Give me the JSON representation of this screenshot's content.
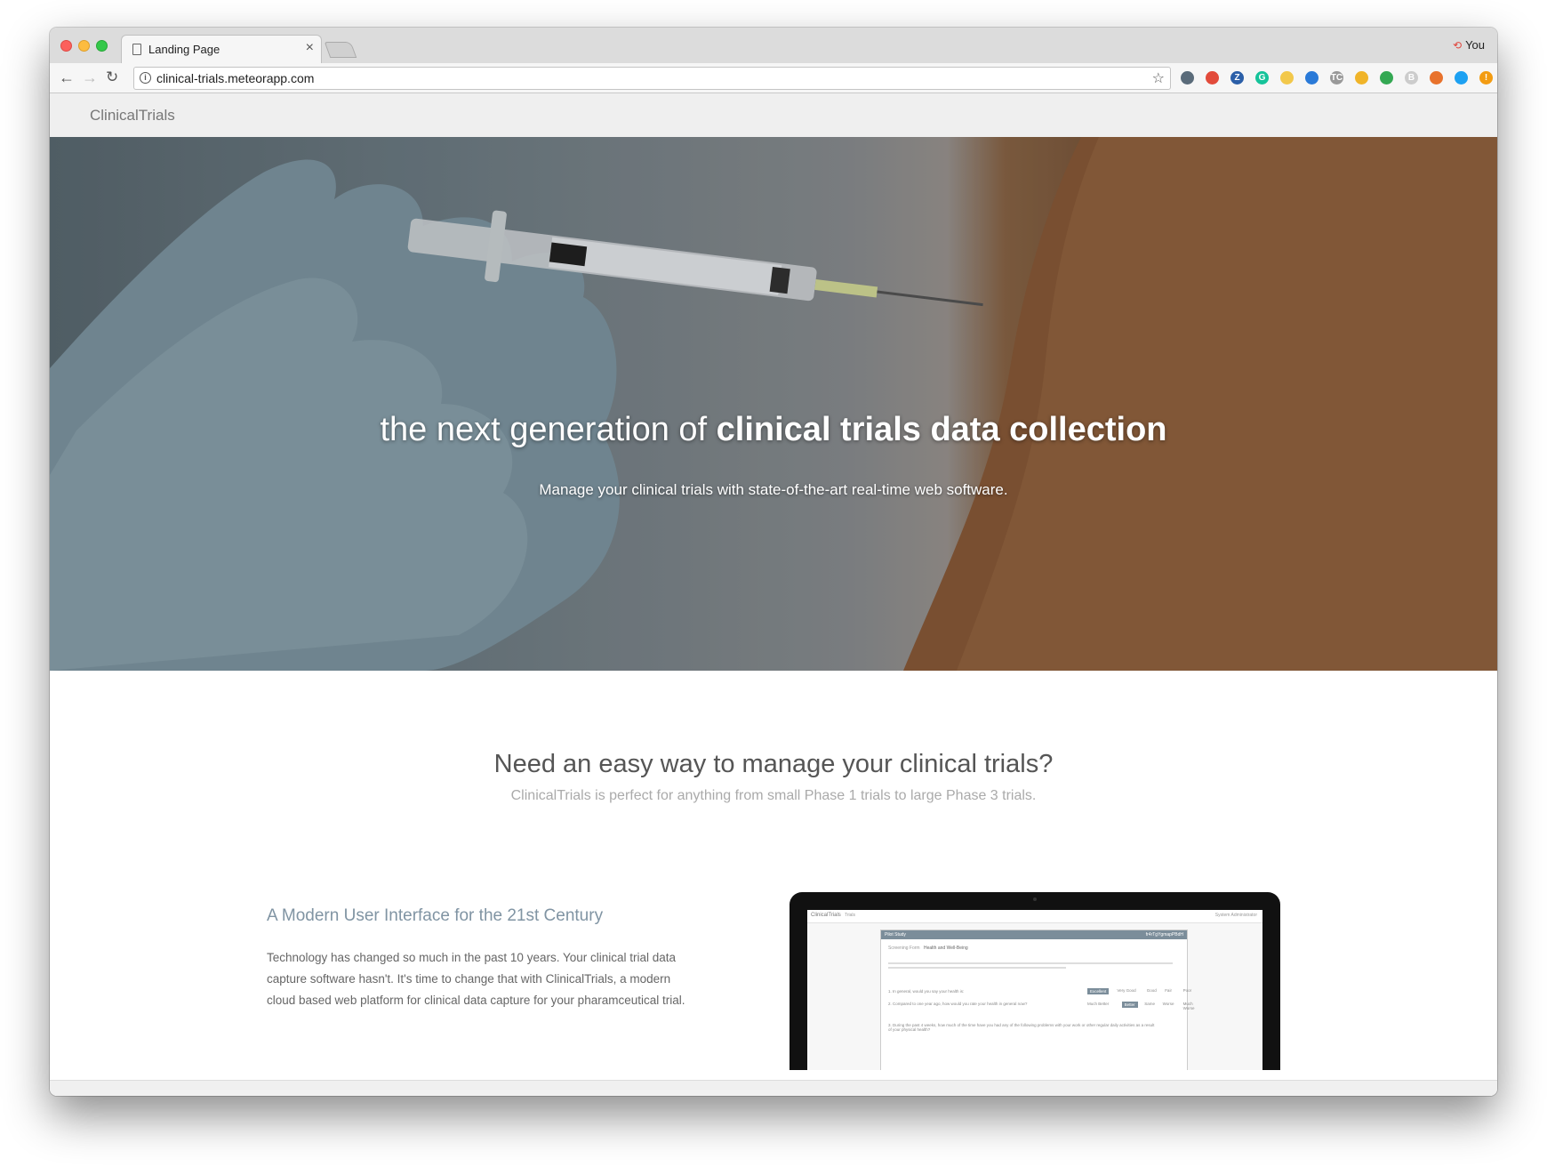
{
  "browser": {
    "tab_title": "Landing Page",
    "tab_close": "×",
    "profile_name": "You",
    "url": "clinical-trials.meteorapp.com",
    "extensions": [
      {
        "name": "cast-icon",
        "color": "#5a6b7a"
      },
      {
        "name": "opera-icon",
        "color": "#e24b3b"
      },
      {
        "name": "zotero-icon",
        "color": "#2b5fa8",
        "glyph": "Z"
      },
      {
        "name": "grammarly-icon",
        "color": "#15c39a",
        "glyph": "G"
      },
      {
        "name": "clock-icon",
        "color": "#f2c84b"
      },
      {
        "name": "globe-icon",
        "color": "#2a7ad8"
      },
      {
        "name": "tc-icon",
        "color": "#999999",
        "glyph": "TC"
      },
      {
        "name": "puzzle-icon",
        "color": "#f0b429"
      },
      {
        "name": "circle-green-icon",
        "color": "#34a853"
      },
      {
        "name": "b-icon",
        "color": "#cccccc",
        "glyph": "B"
      },
      {
        "name": "fox-icon",
        "color": "#e8722c"
      },
      {
        "name": "send-icon",
        "color": "#1da1f2"
      },
      {
        "name": "warning-icon",
        "color": "#f39c12",
        "glyph": "!"
      }
    ]
  },
  "site": {
    "brand": "ClinicalTrials"
  },
  "hero": {
    "title_light": "the next generation of ",
    "title_bold": "clinical trials data collection",
    "subtitle": "Manage your clinical trials with state-of-the-art real-time web software."
  },
  "intro": {
    "heading": "Need an easy way to manage your clinical trials?",
    "subheading": "ClinicalTrials is perfect for anything from small Phase 1 trials to large Phase 3 trials."
  },
  "feature": {
    "title": "A Modern User Interface for the 21st Century",
    "body": "Technology has changed so much in the past 10 years. Your clinical trial data capture software hasn't. It's time to change that with ClinicalTrials, a modern cloud based web platform for clinical data capture for your pharamceutical trial."
  },
  "screenshot": {
    "brand": "ClinicalTrials",
    "nav_item": "Trials",
    "user": "System Administrator",
    "card_title": "Pilot Study",
    "card_id": "fr4rTgYgmapPBdH",
    "tab_1": "Screening Form",
    "tab_2": "Health and Well-Being",
    "q1": "1. In general, would you say your health is:",
    "q1_options": [
      "Excellent",
      "Very Good",
      "Good",
      "Fair",
      "Poor"
    ],
    "q2": "2. Compared to one year ago, how would you rate your health in general now?",
    "q2_options": [
      "Much Better",
      "Better",
      "Same",
      "Worse",
      "Much Worse"
    ],
    "q3": "3. During the past 4 weeks, how much of the time have you had any of the following problems with your work or other regular daily activities as a result of your physical health?"
  }
}
